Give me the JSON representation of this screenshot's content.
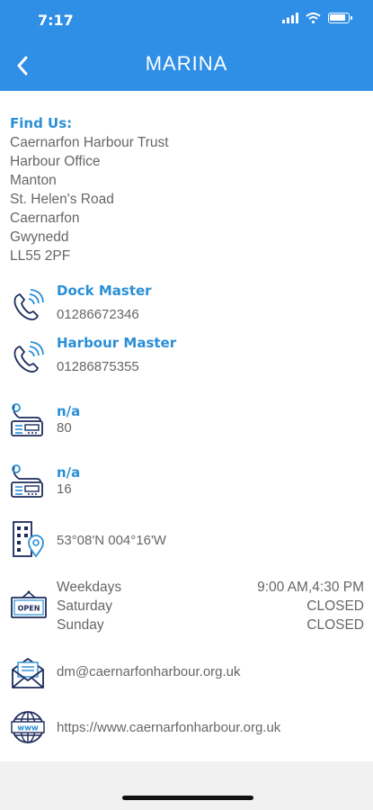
{
  "status": {
    "time": "7:17"
  },
  "header": {
    "title": "MARINA"
  },
  "find_us": {
    "title": "Find Us:",
    "address": [
      "Caernarfon Harbour Trust",
      "Harbour Office",
      "Manton",
      "St. Helen's Road",
      "Caernarfon",
      "Gwynedd",
      "LL55 2PF"
    ]
  },
  "contacts": [
    {
      "label": "Dock Master",
      "value": "01286672346"
    },
    {
      "label": "Harbour Master",
      "value": "01286875355"
    }
  ],
  "radio": [
    {
      "label": "n/a",
      "value": "80"
    },
    {
      "label": "n/a",
      "value": "16"
    }
  ],
  "location": {
    "coords": "53°08'N 004°16'W"
  },
  "hours": [
    {
      "day": "Weekdays",
      "time": "9:00 AM,4:30 PM"
    },
    {
      "day": "Saturday",
      "time": "CLOSED"
    },
    {
      "day": "Sunday",
      "time": "CLOSED"
    }
  ],
  "email": {
    "address": "dm@caernarfonharbour.org.uk"
  },
  "website": {
    "url": "https://www.caernarfonharbour.org.uk"
  },
  "colors": {
    "header": "#2f8fe6",
    "accent": "#2a8fd6",
    "icon": "#1d2b5c"
  }
}
